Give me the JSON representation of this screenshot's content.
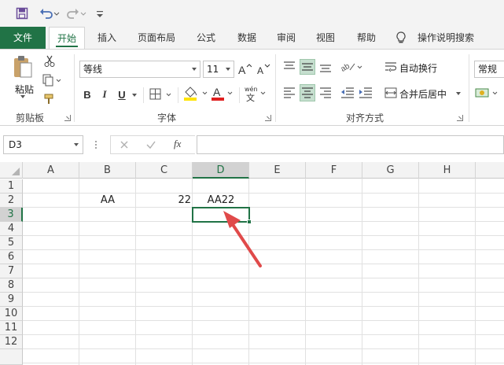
{
  "qat": {
    "save_icon": "save-icon",
    "undo_icon": "undo-icon",
    "redo_icon": "redo-icon",
    "customize_icon": "customize-icon"
  },
  "tabs": [
    {
      "label": "文件"
    },
    {
      "label": "开始"
    },
    {
      "label": "插入"
    },
    {
      "label": "页面布局"
    },
    {
      "label": "公式"
    },
    {
      "label": "数据"
    },
    {
      "label": "审阅"
    },
    {
      "label": "视图"
    },
    {
      "label": "帮助"
    },
    {
      "label": "操作说明搜索"
    }
  ],
  "ribbon": {
    "clipboard": {
      "paste_label": "粘贴",
      "group_label": "剪贴板"
    },
    "font": {
      "font_name": "等线",
      "font_size": "11",
      "bold": "B",
      "italic": "I",
      "underline": "U",
      "font_color_letter": "A",
      "phonetic": "wén",
      "group_label": "字体"
    },
    "alignment": {
      "wrap_text": "自动换行",
      "merge_center": "合并后居中",
      "group_label": "对齐方式"
    },
    "number": {
      "format": "常规"
    }
  },
  "formula_bar": {
    "name_box": "D3",
    "fx_label": "fx",
    "formula": ""
  },
  "columns": [
    "A",
    "B",
    "C",
    "D",
    "E",
    "F",
    "G",
    "H"
  ],
  "rows": [
    "1",
    "2",
    "3",
    "4",
    "5",
    "6",
    "7",
    "8",
    "9",
    "10",
    "11",
    "12"
  ],
  "cells": {
    "B2": "AA",
    "C2": "22",
    "D2": "AA22"
  },
  "selected_cell": "D3",
  "colors": {
    "accent": "#217346",
    "arrow": "#e04a4a"
  }
}
